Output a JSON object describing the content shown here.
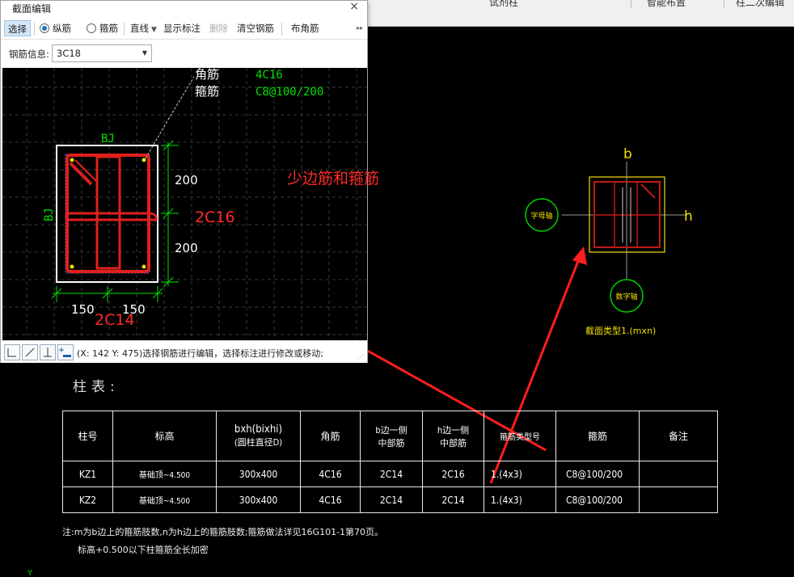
{
  "topbar": {
    "items": [
      "试剂柱",
      "智能布置",
      "柱二次编辑"
    ]
  },
  "dialog": {
    "title": "截面编辑",
    "close_glyph": "×",
    "toolbar": {
      "select": "选择",
      "longitudinal": "纵筋",
      "stirrup": "箍筋",
      "line": "直线",
      "show_mark": "显示标注",
      "delete": "删除",
      "clear": "清空钢筋",
      "corner": "布角筋",
      "more": "▸▸"
    },
    "rebar_info_label": "钢筋信息:",
    "rebar_info_value": "3C18",
    "drawing": {
      "corner_label": "角筋",
      "corner_value": "4C16",
      "stirrup_label": "箍筋",
      "stirrup_value": "C8@100/200",
      "bj_top": "BJ",
      "bj_left": "BJ",
      "dim_200_top": "200",
      "dim_200_bottom": "200",
      "dim_150_left": "150",
      "dim_150_right": "150",
      "side_rebar": "2C16",
      "bottom_rebar": "2C14",
      "annotation": "少边筋和箍筋"
    },
    "status_text": "(X: 142 Y: 475)选择钢筋进行编辑，选择标注进行修改或移动;"
  },
  "detail": {
    "label_b": "b",
    "label_h": "h",
    "circle_left": "字母轴",
    "circle_bottom": "数字轴",
    "caption": "截面类型1.(mxn)"
  },
  "table": {
    "title": "柱表:",
    "headers": [
      "柱号",
      "标高",
      "bxh(bixhi)",
      "(圆柱直径D)",
      "角筋",
      "b边一侧",
      "中部筋",
      "h边一侧",
      "中部筋",
      "箍筋类型号",
      "箍筋",
      "备注"
    ],
    "rows": [
      [
        "KZ1",
        "基础顶~4.500",
        "300x400",
        "4C16",
        "2C14",
        "2C16",
        "1.(4x3)",
        "C8@100/200",
        ""
      ],
      [
        "KZ2",
        "基础顶~4.500",
        "300x400",
        "4C16",
        "2C14",
        "2C14",
        "1.(4x3)",
        "C8@100/200",
        ""
      ]
    ],
    "note1": "注:m为b边上的箍筋肢数,n为h边上的箍筋肢数;箍筋做法详见16G101-1第70页。",
    "note2": "标高+0.500以下柱箍筋全长加密"
  },
  "colors": {
    "rebar": "#e0201c",
    "dim": "#00e000",
    "annotation": "#ff2a2a",
    "frame_yellow": "#f0e000",
    "dialog_bg": "#ffffff"
  }
}
